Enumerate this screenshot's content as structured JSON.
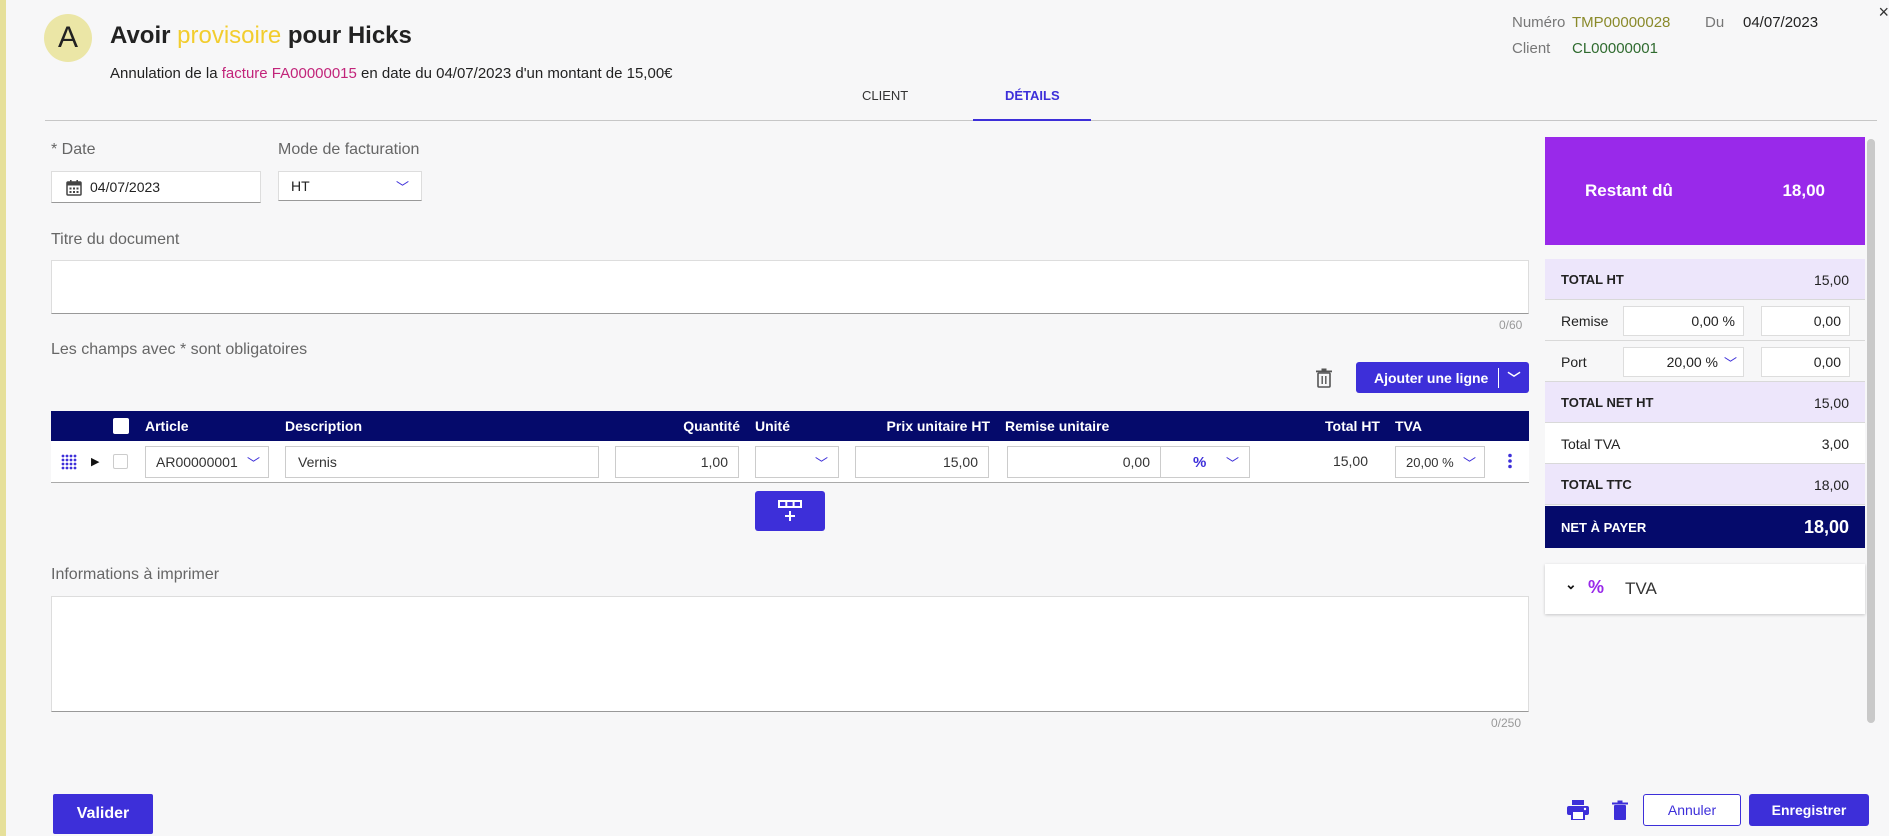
{
  "header": {
    "avatar_letter": "A",
    "title_prefix": "Avoir ",
    "title_accent": "provisoire",
    "title_suffix": " pour Hicks",
    "subtitle_prefix": "Annulation de la ",
    "subtitle_link": "facture FA00000015",
    "subtitle_suffix": " en date du 04/07/2023 d'un montant de 15,00€",
    "numero_label": "Numéro",
    "numero_value": "TMP00000028",
    "du_label": "Du",
    "du_value": "04/07/2023",
    "client_label": "Client",
    "client_value": "CL00000001",
    "close_glyph": "×"
  },
  "tabs": [
    {
      "label": "CLIENT",
      "active": false
    },
    {
      "label": "DÉTAILS",
      "active": true
    }
  ],
  "form": {
    "date_label": "* Date",
    "date_value": "04/07/2023",
    "mode_label": "Mode de facturation",
    "mode_value": "HT",
    "titre_label": "Titre du document",
    "titre_value": "",
    "titre_counter": "0/60",
    "mandatory_note": "Les champs avec * sont obligatoires",
    "infos_label": "Informations à imprimer",
    "infos_value": "",
    "infos_counter": "0/250"
  },
  "toolbar": {
    "add_line_label": "Ajouter une ligne",
    "trash_icon": "trash-icon"
  },
  "table": {
    "headers": {
      "article": "Article",
      "description": "Description",
      "quantite": "Quantité",
      "unite": "Unité",
      "prix": "Prix unitaire HT",
      "remise": "Remise unitaire",
      "total": "Total HT",
      "tva": "TVA"
    },
    "rows": [
      {
        "article": "AR00000001",
        "description": "Vernis",
        "quantite": "1,00",
        "unite": "",
        "prix": "15,00",
        "remise": "0,00",
        "remise_type": "%",
        "total": "15,00",
        "tva": "20,00 %"
      }
    ]
  },
  "summary": {
    "restant_label": "Restant dû",
    "restant_value": "18,00",
    "total_ht_label": "TOTAL HT",
    "total_ht_value": "15,00",
    "remise_label": "Remise",
    "remise_pct": "0,00 %",
    "remise_amount": "0,00",
    "port_label": "Port",
    "port_pct": "20,00 %",
    "port_amount": "0,00",
    "total_net_ht_label": "TOTAL NET HT",
    "total_net_ht_value": "15,00",
    "total_tva_label": "Total TVA",
    "total_tva_value": "3,00",
    "total_ttc_label": "TOTAL TTC",
    "total_ttc_value": "18,00",
    "net_payer_label": "NET À PAYER",
    "net_payer_value": "18,00",
    "tva_section_label": "TVA"
  },
  "footer": {
    "valider_label": "Valider",
    "annuler_label": "Annuler",
    "enregistrer_label": "Enregistrer"
  },
  "colors": {
    "primary": "#3d2fd9",
    "navy": "#050a6b",
    "purple": "#9929ea",
    "accent_yellow": "#f2cd2e",
    "link_pink": "#c2247a"
  }
}
